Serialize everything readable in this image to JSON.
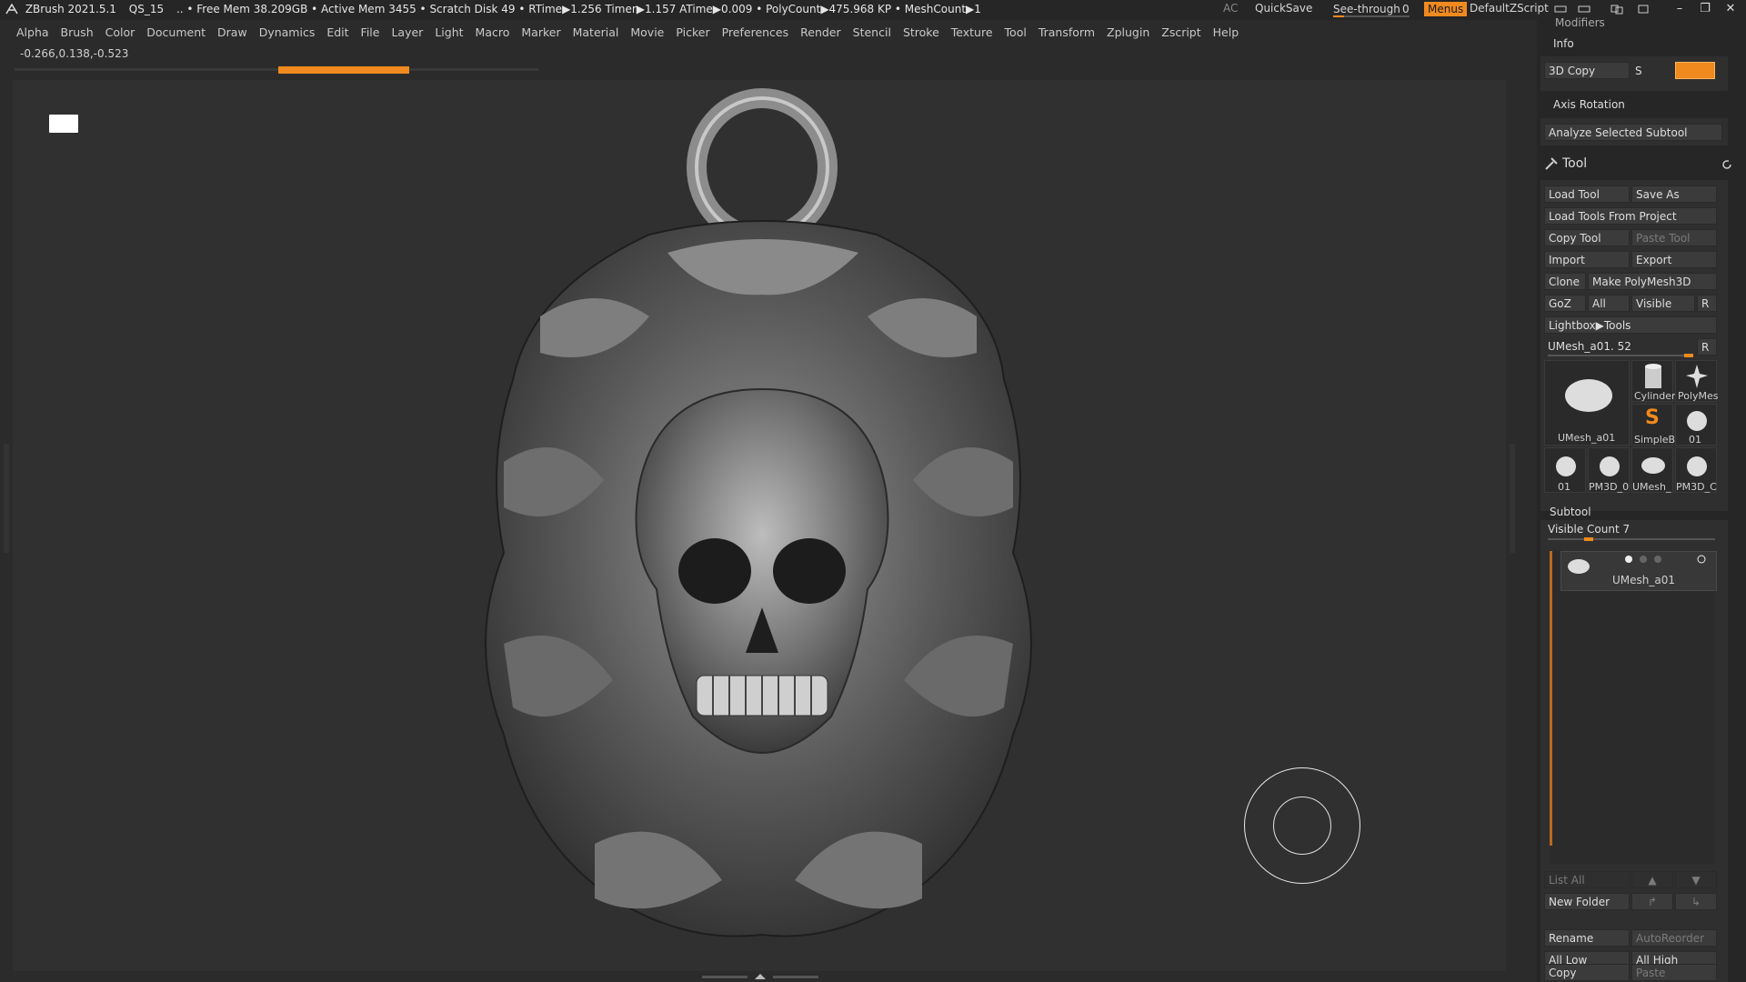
{
  "titlebar": {
    "app": "ZBrush 2021.5.1",
    "project": "QS_15",
    "stats": "..  • Free Mem 38.209GB • Active Mem 3455 • Scratch Disk 49 •  RTime▶1.256 Timer▶1.157 ATime▶0.009 • PolyCount▶475.968 KP  • MeshCount▶1",
    "ac": "AC",
    "quicksave": "QuickSave",
    "see_through_label": "See-through",
    "see_through_value": "0",
    "see_through_fraction": 0.14,
    "menus": "Menus",
    "script": "DefaultZScript"
  },
  "menubar": {
    "items": [
      "Alpha",
      "Brush",
      "Color",
      "Document",
      "Draw",
      "Dynamics",
      "Edit",
      "File",
      "Layer",
      "Light",
      "Macro",
      "Marker",
      "Material",
      "Movie",
      "Picker",
      "Preferences",
      "Render",
      "Stencil",
      "Stroke",
      "Texture",
      "Tool",
      "Transform",
      "Zplugin",
      "Zscript",
      "Help"
    ]
  },
  "coords": "-0.266,0.138,-0.523",
  "colors": {
    "accent": "#f08a1e",
    "bg": "#2b2b2b",
    "canvas": "#303030",
    "panel": "#262626"
  },
  "tray": {
    "modifiers": "Modifiers",
    "info": "Info",
    "copy3d": "3D Copy",
    "s_label": "S",
    "axis_rotation": "Axis Rotation",
    "analyze": "Analyze Selected Subtool",
    "tool_title": "Tool",
    "load_tool": "Load Tool",
    "save_as": "Save As",
    "load_from_project": "Load Tools From Project",
    "copy_tool": "Copy Tool",
    "paste_tool": "Paste Tool",
    "import": "Import",
    "export": "Export",
    "clone": "Clone",
    "make_polymesh": "Make PolyMesh3D",
    "goz": "GoZ",
    "all": "All",
    "visible": "Visible",
    "r": "R",
    "lightbox_tools": "Lightbox▶Tools",
    "current_tool": "UMesh_a01. 52",
    "thumbs": {
      "main": "UMesh_a01",
      "cylinder": "Cylinder",
      "polymesh": "PolyMes",
      "simpleb": "SimpleB",
      "s01": "01",
      "t1": "01",
      "t2": "PM3D_0",
      "t3": "UMesh_",
      "t4": "PM3D_C"
    },
    "subtool_title": "Subtool",
    "visible_count": "Visible Count 7",
    "subtool_name": "UMesh_a01",
    "list_all": "List All",
    "new_folder": "New Folder",
    "rename": "Rename",
    "auto_reorder": "AutoReorder",
    "all_low": "All Low",
    "all_high": "All High",
    "copy": "Copy",
    "paste": "Paste"
  }
}
